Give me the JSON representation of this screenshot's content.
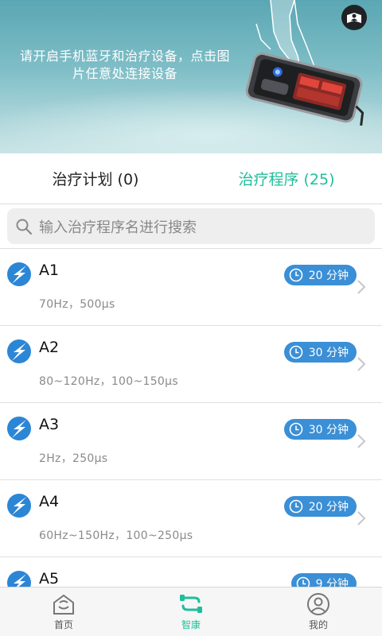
{
  "banner": {
    "message": "请开启手机蓝牙和治疗设备，点击图片任意处连接设备",
    "device_image": "device-hand-press-illustration",
    "help_icon": "book-person-icon"
  },
  "tabs": [
    {
      "label": "治疗计划 (0)",
      "active": false
    },
    {
      "label": "治疗程序 (25)",
      "active": true
    }
  ],
  "search": {
    "placeholder": "输入治疗程序名进行搜索",
    "icon": "search-icon"
  },
  "programs": [
    {
      "name": "A1",
      "params": "70Hz，500μs",
      "duration": "20 分钟"
    },
    {
      "name": "A2",
      "params": "80~120Hz，100~150μs",
      "duration": "30 分钟"
    },
    {
      "name": "A3",
      "params": "2Hz，250μs",
      "duration": "30 分钟"
    },
    {
      "name": "A4",
      "params": "60Hz~150Hz，100~250μs",
      "duration": "20 分钟"
    },
    {
      "name": "A5",
      "params": "",
      "duration": "9 分钟"
    }
  ],
  "nav": [
    {
      "label": "首页",
      "icon": "home-icon",
      "active": false
    },
    {
      "label": "智康",
      "icon": "plug-icon",
      "active": true
    },
    {
      "label": "我的",
      "icon": "user-icon",
      "active": false
    }
  ],
  "colors": {
    "accent": "#1fbe9b",
    "badge": "#3a8fd6",
    "bolt": "#2c86d6"
  }
}
